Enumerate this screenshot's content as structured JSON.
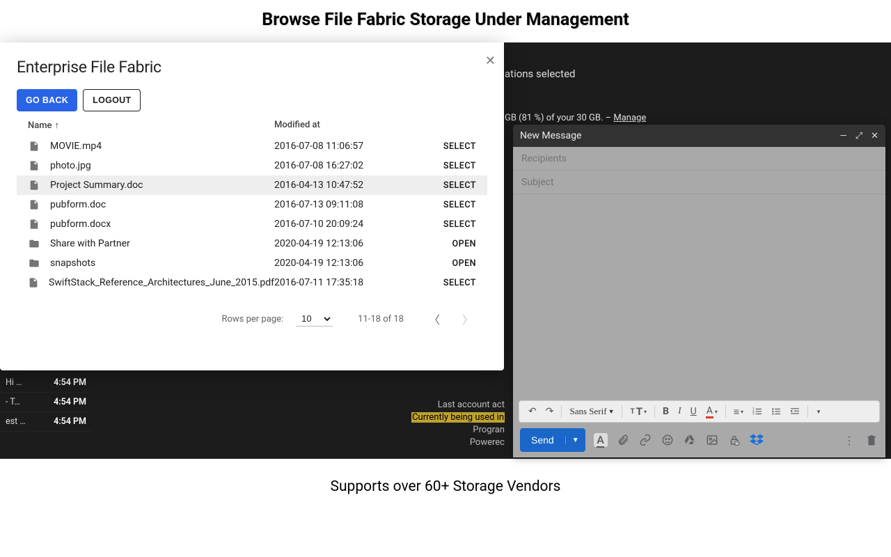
{
  "headings": {
    "top": "Browse File Fabric Storage Under Management",
    "bottom": "Supports over 60+ Storage Vendors"
  },
  "bg": {
    "selection_suffix": "ations selected",
    "storage_line_prefix": "GB (81 %) of your 30 GB. – ",
    "storage_manage": "Manage",
    "inbox_rows": [
      {
        "label": "Hi …",
        "time": "4:54 PM"
      },
      {
        "label": "- T…",
        "time": "4:54 PM"
      },
      {
        "label": "est …",
        "time": "4:54 PM"
      }
    ],
    "acct_l1": "Last account act",
    "acct_l2": "Currently being used in",
    "acct_l3": "Progran",
    "acct_l4": "Powerec"
  },
  "modal": {
    "title": "Enterprise File Fabric",
    "go_back": "GO BACK",
    "logout": "LOGOUT",
    "col_name": "Name",
    "col_modified": "Modified at",
    "action_select": "SELECT",
    "action_open": "OPEN",
    "rows": [
      {
        "icon": "file",
        "name": "MOVIE.mp4",
        "mod": "2016-07-08 11:06:57",
        "act": "SELECT",
        "sel": false
      },
      {
        "icon": "file",
        "name": "photo.jpg",
        "mod": "2016-07-08 16:27:02",
        "act": "SELECT",
        "sel": false
      },
      {
        "icon": "file",
        "name": "Project Summary.doc",
        "mod": "2016-04-13 10:47:52",
        "act": "SELECT",
        "sel": true
      },
      {
        "icon": "file",
        "name": "pubform.doc",
        "mod": "2016-07-13 09:11:08",
        "act": "SELECT",
        "sel": false
      },
      {
        "icon": "file",
        "name": "pubform.docx",
        "mod": "2016-07-10 20:09:24",
        "act": "SELECT",
        "sel": false
      },
      {
        "icon": "folder",
        "name": "Share with Partner",
        "mod": "2020-04-19 12:13:06",
        "act": "OPEN",
        "sel": false
      },
      {
        "icon": "folder",
        "name": "snapshots",
        "mod": "2020-04-19 12:13:06",
        "act": "OPEN",
        "sel": false
      },
      {
        "icon": "file",
        "name": "SwiftStack_Reference_Architectures_June_2015.pdf",
        "mod": "2016-07-11 17:35:18",
        "act": "SELECT",
        "sel": false
      }
    ],
    "pager": {
      "rows_label": "Rows per page:",
      "rows_value": "10",
      "range": "11-18 of 18"
    }
  },
  "compose": {
    "title": "New Message",
    "recipients": "Recipients",
    "subject": "Subject",
    "font": "Sans Serif",
    "send": "Send"
  }
}
